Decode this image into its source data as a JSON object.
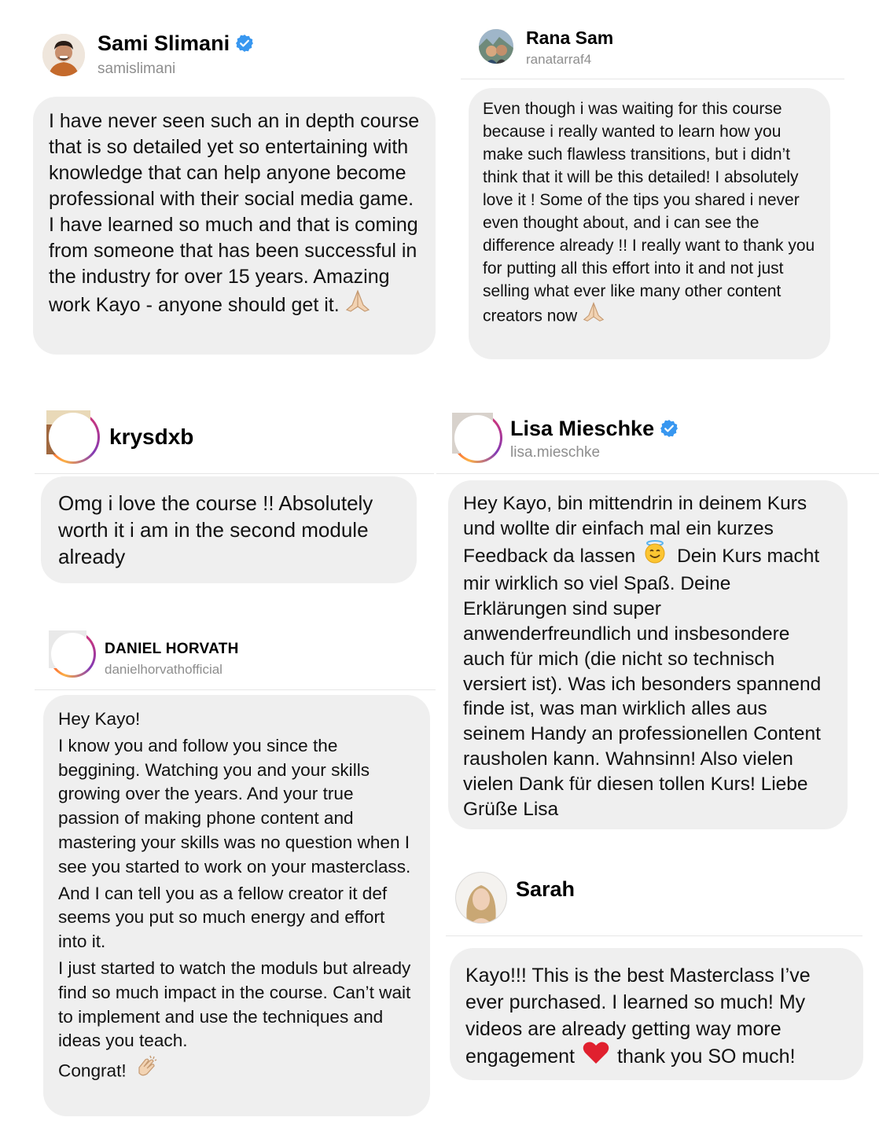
{
  "cards": {
    "sami": {
      "name": "Sami Slimani",
      "handle": "samislimani",
      "verified": true,
      "message": "I have never seen such an in depth course that is so detailed yet so entertaining with knowledge that can help anyone become professional with their social media game. I have learned so much and that is coming from someone that has been successful in the industry for over 15 years. Amazing work Kayo - anyone should get it.",
      "emoji": "folded-hands"
    },
    "rana": {
      "name": "Rana Sam",
      "handle": "ranatarraf4",
      "message": "Even though i was waiting for this course because i really wanted to learn how you make such flawless transitions, but i didn’t think that it will be this detailed! I absolutely love it ! Some of the tips you shared i never even thought about, and i can see the difference already !! I really want to thank you for putting all this effort into it and not just selling what ever like many other content creators now",
      "emoji": "folded-hands"
    },
    "krys": {
      "name": "krysdxb",
      "message": "Omg i love the course !! Absolutely worth it i am in the second module already"
    },
    "lisa": {
      "name": "Lisa Mieschke",
      "handle": "lisa.mieschke",
      "verified": true,
      "message_before": "Hey Kayo, bin mittendrin in deinem Kurs und wollte dir einfach mal ein kurzes Feedback da lassen",
      "message_after": "Dein Kurs macht mir wirklich so viel Spaß. Deine Erklärungen sind super anwenderfreundlich und insbesondere auch für mich (die nicht so technisch versiert ist). Was ich besonders spannend finde ist, was man wirklich alles aus seinem Handy an professionellen Content rausholen kann. Wahnsinn! Also vielen vielen Dank für diesen tollen Kurs! Liebe Grüße Lisa",
      "emoji": "smiling-face-with-halo"
    },
    "daniel": {
      "name": "DANIEL HORVATH",
      "handle": "danielhorvathofficial",
      "paragraphs": [
        "Hey Kayo!",
        "I know you and follow you since the beggining. Watching you and your skills growing over the years. And your true passion of making phone content and mastering your skills was no question when I see you started to work on your masterclass.",
        "And I can tell you as a fellow creator it def seems you put so much energy and effort into it.",
        "I just started to watch the moduls but already find so much impact in the course. Can’t wait to implement and use the techniques and ideas you teach."
      ],
      "closing": "Congrat!",
      "emoji": "clapping-hands"
    },
    "sarah": {
      "name": "Sarah",
      "message_before": "Kayo!!! This is the best Masterclass I’ve ever purchased. I learned so much! My videos are already getting way more engagement",
      "message_after": "thank you SO much!",
      "emoji": "red-heart"
    }
  },
  "colors": {
    "bubble": "#efefef",
    "verified": "#3897f0",
    "handle": "#8e8e8e",
    "heart": "#e0202e"
  }
}
